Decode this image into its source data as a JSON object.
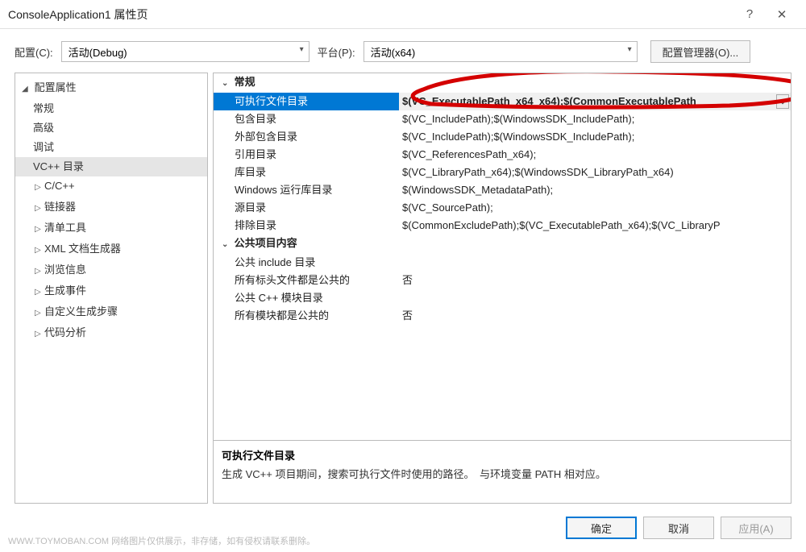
{
  "window": {
    "title": "ConsoleApplication1 属性页",
    "help_icon": "?",
    "close_icon": "✕"
  },
  "toolbar": {
    "config_label": "配置(C):",
    "config_value": "活动(Debug)",
    "platform_label": "平台(P):",
    "platform_value": "活动(x64)",
    "config_manager": "配置管理器(O)..."
  },
  "tree": {
    "root": "配置属性",
    "items": [
      "常规",
      "高级",
      "调试",
      "VC++ 目录"
    ],
    "sub_items": [
      "C/C++",
      "链接器",
      "清单工具",
      "XML 文档生成器",
      "浏览信息",
      "生成事件",
      "自定义生成步骤",
      "代码分析"
    ],
    "selected_index": 3
  },
  "props": {
    "section1": "常规",
    "rows1": [
      {
        "name": "可执行文件目录",
        "value": "$(VC_ExecutablePath_x64_x64);$(CommonExecutablePath"
      },
      {
        "name": "包含目录",
        "value": "$(VC_IncludePath);$(WindowsSDK_IncludePath);"
      },
      {
        "name": "外部包含目录",
        "value": "$(VC_IncludePath);$(WindowsSDK_IncludePath);"
      },
      {
        "name": "引用目录",
        "value": "$(VC_ReferencesPath_x64);"
      },
      {
        "name": "库目录",
        "value": "$(VC_LibraryPath_x64);$(WindowsSDK_LibraryPath_x64)"
      },
      {
        "name": "Windows 运行库目录",
        "value": "$(WindowsSDK_MetadataPath);"
      },
      {
        "name": "源目录",
        "value": "$(VC_SourcePath);"
      },
      {
        "name": "排除目录",
        "value": "$(CommonExcludePath);$(VC_ExecutablePath_x64);$(VC_LibraryP"
      }
    ],
    "section2": "公共项目内容",
    "rows2": [
      {
        "name": "公共 include 目录",
        "value": ""
      },
      {
        "name": "所有标头文件都是公共的",
        "value": "否"
      },
      {
        "name": "公共 C++ 模块目录",
        "value": ""
      },
      {
        "name": "所有模块都是公共的",
        "value": "否"
      }
    ],
    "selected_row": 0
  },
  "description": {
    "title": "可执行文件目录",
    "text": "生成 VC++ 项目期间，搜索可执行文件时使用的路径。　与环境变量 PATH 相对应。"
  },
  "buttons": {
    "ok": "确定",
    "cancel": "取消",
    "apply": "应用(A)"
  },
  "watermark": "WWW.TOYMOBAN.COM  网络图片仅供展示，非存储，如有侵权请联系删除。"
}
